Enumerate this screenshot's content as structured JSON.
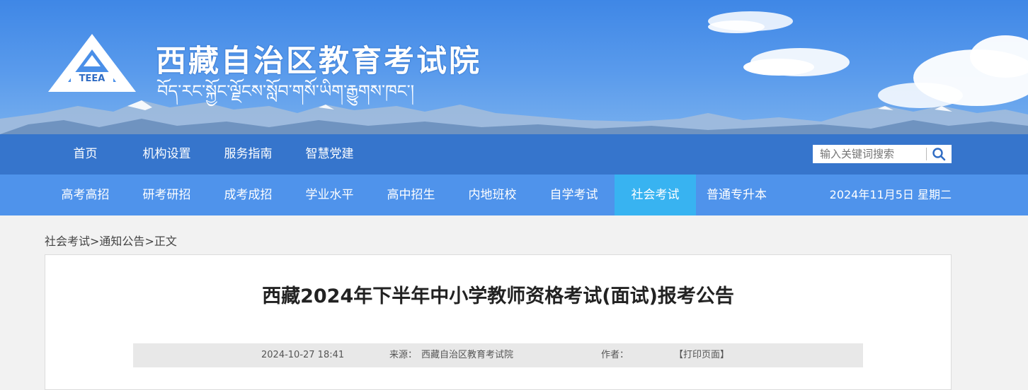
{
  "header": {
    "title_cn": "西藏自治区教育考试院",
    "title_bo": "བོད་རང་སྐྱོང་ལྗོངས་སློབ་གསོ་ཡིག་རྒྱུགས་ཁང་།",
    "logo_text": "TEEA",
    "colors": {
      "sky": "#4a8fe8",
      "nav_primary": "#3675cc",
      "nav_secondary": "#4f93eb",
      "nav_active": "#38b3f1"
    }
  },
  "nav_primary": {
    "items": [
      "首页",
      "机构设置",
      "服务指南",
      "智慧党建"
    ]
  },
  "search": {
    "placeholder": "输入关键词搜索",
    "icon": "search-icon"
  },
  "nav_secondary": {
    "items": [
      "高考高招",
      "研考研招",
      "成考成招",
      "学业水平",
      "高中招生",
      "内地班校",
      "自学考试",
      "社会考试",
      "普通专升本"
    ],
    "active": "社会考试",
    "date": "2024年11月5日 星期二"
  },
  "breadcrumb": {
    "section": "社会考试",
    "sep": ">",
    "subsection": "通知公告",
    "current": "正文"
  },
  "article": {
    "title": "西藏2024年下半年中小学教师资格考试(面试)报考公告",
    "datetime": "2024-10-27 18:41",
    "source_label": "来源：",
    "source": "西藏自治区教育考试院",
    "author_label": "作者：",
    "print_label": "【打印页面】"
  }
}
